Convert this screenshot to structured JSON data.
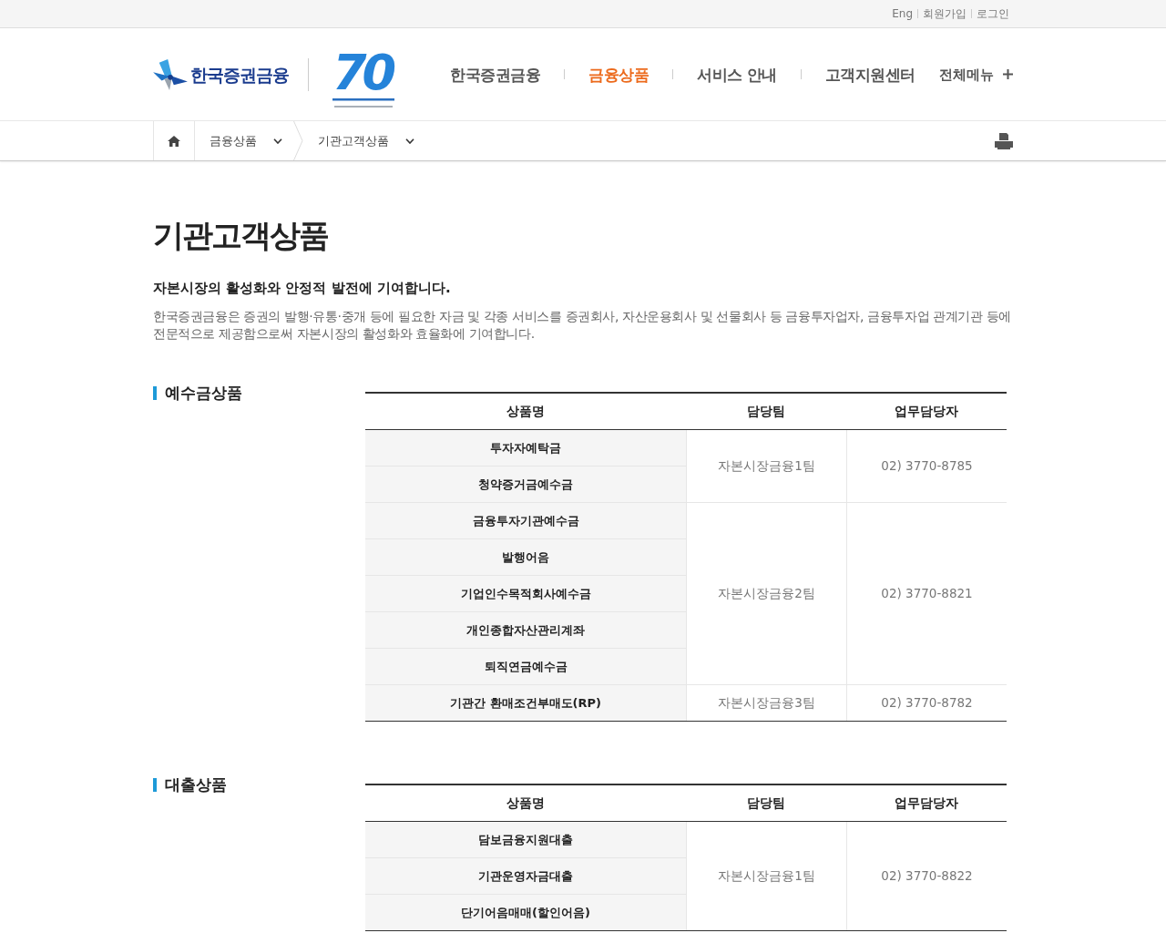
{
  "top_links": [
    {
      "label": "Eng"
    },
    {
      "label": "회원가입"
    },
    {
      "label": "로그인"
    }
  ],
  "logo": {
    "name": "한국증권금융",
    "emblem": "70"
  },
  "nav": [
    {
      "label": "한국증권금융",
      "selected": false
    },
    {
      "label": "금융상품",
      "selected": true
    },
    {
      "label": "서비스 안내",
      "selected": false
    },
    {
      "label": "고객지원센터",
      "selected": false
    }
  ],
  "all_menu": {
    "label": "전체메뉴"
  },
  "breadcrumb": [
    {
      "label": "금융상품"
    },
    {
      "label": "기관고객상품"
    }
  ],
  "page": {
    "title": "기관고객상품",
    "subtitle": "자본시장의 활성화와 안정적 발전에 기여합니다.",
    "description": "한국증권금융은 증권의 발행·유통·중개 등에 필요한 자금 및 각종 서비스를 증권회사, 자산운용회사 및 선물회사 등 금융투자업자, 금융투자업 관계기관 등에 전문적으로 제공함으로써 자본시장의 활성화와 효율화에 기여합니다."
  },
  "sections": [
    {
      "title": "예수금상품",
      "columns": [
        "상품명",
        "담당팀",
        "업무담당자"
      ],
      "groups": [
        {
          "products": [
            "투자자예탁금",
            "청약증거금예수금"
          ],
          "team": "자본시장금융1팀",
          "contact": "02) 3770-8785"
        },
        {
          "products": [
            "금융투자기관예수금",
            "발행어음",
            "기업인수목적회사예수금",
            "개인종합자산관리계좌",
            "퇴직연금예수금"
          ],
          "team": "자본시장금융2팀",
          "contact": "02) 3770-8821"
        },
        {
          "products": [
            "기관간 환매조건부매도(RP)"
          ],
          "team": "자본시장금융3팀",
          "contact": "02) 3770-8782"
        }
      ]
    },
    {
      "title": "대출상품",
      "columns": [
        "상품명",
        "담당팀",
        "업무담당자"
      ],
      "groups": [
        {
          "products": [
            "담보금융지원대출",
            "기관운영자금대출",
            "단기어음매매(할인어음)"
          ],
          "team": "자본시장금융1팀",
          "contact": "02) 3770-8822"
        }
      ]
    }
  ]
}
